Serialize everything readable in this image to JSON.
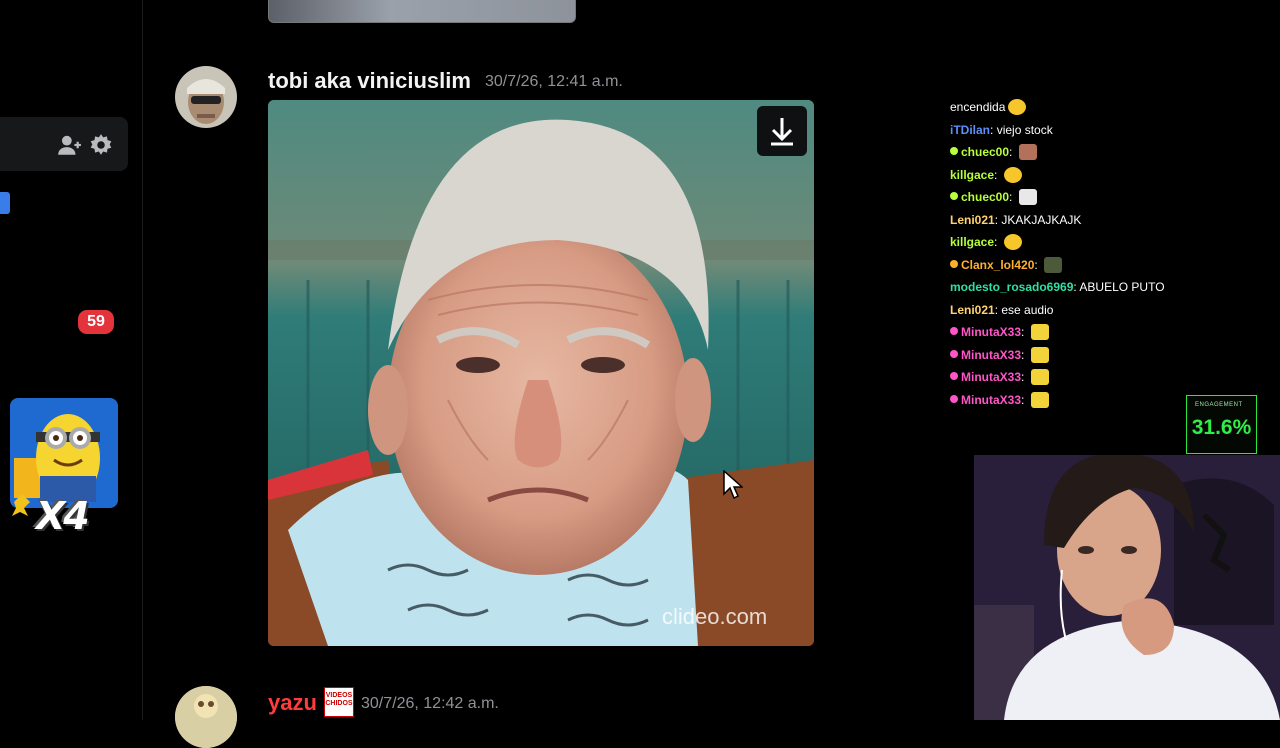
{
  "sidebar": {
    "unread_count": "59",
    "sticker_label": "X4"
  },
  "messages": [
    {
      "author": "tobi aka viniciuslim",
      "timestamp": "30/7/26, 12:41 a.m.",
      "image_watermark": "clideo.com",
      "author_color": "#f2f3f5"
    },
    {
      "author": "yazu",
      "role_icon_text": "VIDEOS CHIDOS",
      "timestamp": "30/7/26, 12:42 a.m.",
      "author_color": "#ff3b3b"
    }
  ],
  "chat": {
    "lines": [
      {
        "user": "",
        "text": "encendida",
        "user_color": "#ffffff",
        "emote": "grin",
        "badge": false
      },
      {
        "user": "iTDilan",
        "text": "viejo stock",
        "user_color": "#5d8ff7",
        "emote": "",
        "badge": false
      },
      {
        "user": "chuec00",
        "text": "",
        "user_color": "#b8ff3a",
        "emote": "face",
        "badge": true
      },
      {
        "user": "killgace",
        "text": "",
        "user_color": "#b8ff3a",
        "emote": "grin",
        "badge": false
      },
      {
        "user": "chuec00",
        "text": "",
        "user_color": "#b8ff3a",
        "emote": "skull",
        "badge": true
      },
      {
        "user": "Leni021",
        "text": "JKAKJAJKAJK",
        "user_color": "#ffd36e",
        "emote": "",
        "badge": false
      },
      {
        "user": "killgace",
        "text": "",
        "user_color": "#b8ff3a",
        "emote": "grin",
        "badge": false
      },
      {
        "user": "Clanx_lol420",
        "text": "",
        "user_color": "#ffb12b",
        "emote": "frog",
        "badge": true
      },
      {
        "user": "modesto_rosado6969",
        "text": "ABUELO PUTO",
        "user_color": "#2fe0a0",
        "emote": "",
        "badge": false
      },
      {
        "user": "Leni021",
        "text": "ese audio",
        "user_color": "#ffd36e",
        "emote": "",
        "badge": false
      },
      {
        "user": "MinutaX33",
        "text": "",
        "user_color": "#ff55c8",
        "emote": "minion",
        "badge": true
      },
      {
        "user": "MinutaX33",
        "text": "",
        "user_color": "#ff55c8",
        "emote": "minion",
        "badge": true
      },
      {
        "user": "MinutaX33",
        "text": "",
        "user_color": "#ff55c8",
        "emote": "minion",
        "badge": true
      },
      {
        "user": "MinutaX33",
        "text": "",
        "user_color": "#ff55c8",
        "emote": "minion",
        "badge": true
      }
    ]
  },
  "engagement": {
    "label": "ENGAGEMENT",
    "value": "31.6%"
  },
  "colors": {
    "background": "#000000",
    "badge_red": "#e2343a",
    "accent_blue": "#3b7de8",
    "engagement_green": "#2cf045"
  }
}
